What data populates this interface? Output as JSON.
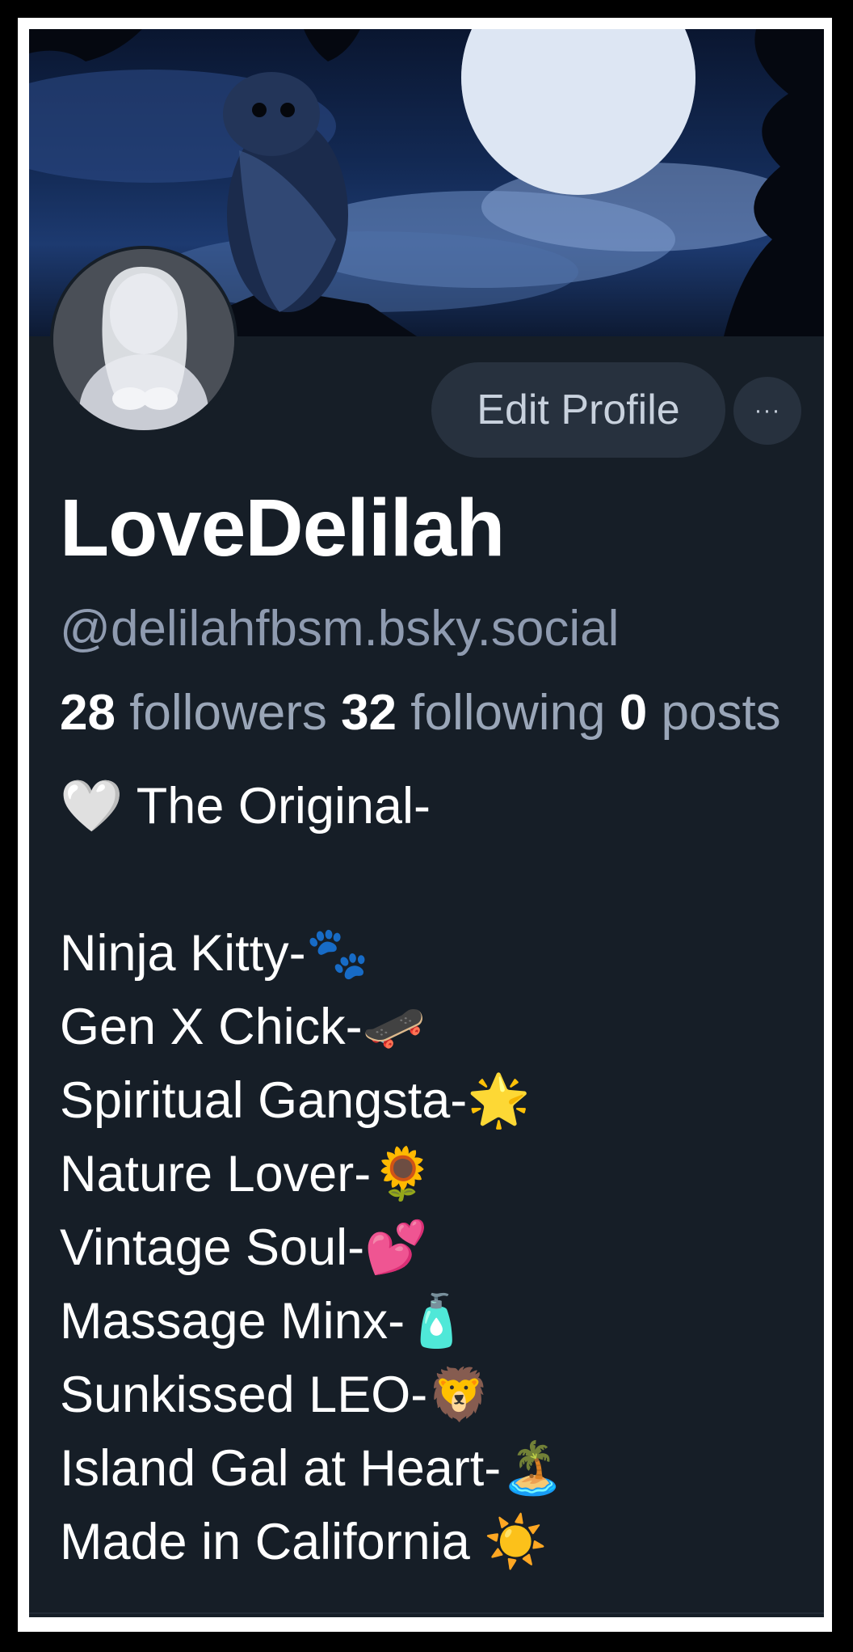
{
  "profile": {
    "display_name": "LoveDelilah",
    "handle": "@delilahfbsm.bsky.social"
  },
  "actions": {
    "edit_profile": "Edit Profile",
    "more": "···"
  },
  "stats": {
    "followers_count": "28",
    "followers_label": "followers",
    "following_count": "32",
    "following_label": "following",
    "posts_count": "0",
    "posts_label": "posts"
  },
  "bio": {
    "first_line": "🤍 The Original-",
    "lines": [
      "Ninja Kitty-🐾",
      "Gen X Chick-🛹",
      "Spiritual Gangsta-🌟",
      "Nature Lover-🌻",
      "Vintage Soul-💕",
      "Massage Minx-🧴",
      "Sunkissed LEO-🦁",
      "Island Gal at Heart-🏝️",
      "Made in California ☀️"
    ]
  },
  "icons": {
    "banner": "owl-moon-night-banner",
    "avatar": "profile-avatar"
  },
  "colors": {
    "background": "#161e27",
    "button": "#27313e",
    "muted_text": "#8f9bb0"
  }
}
